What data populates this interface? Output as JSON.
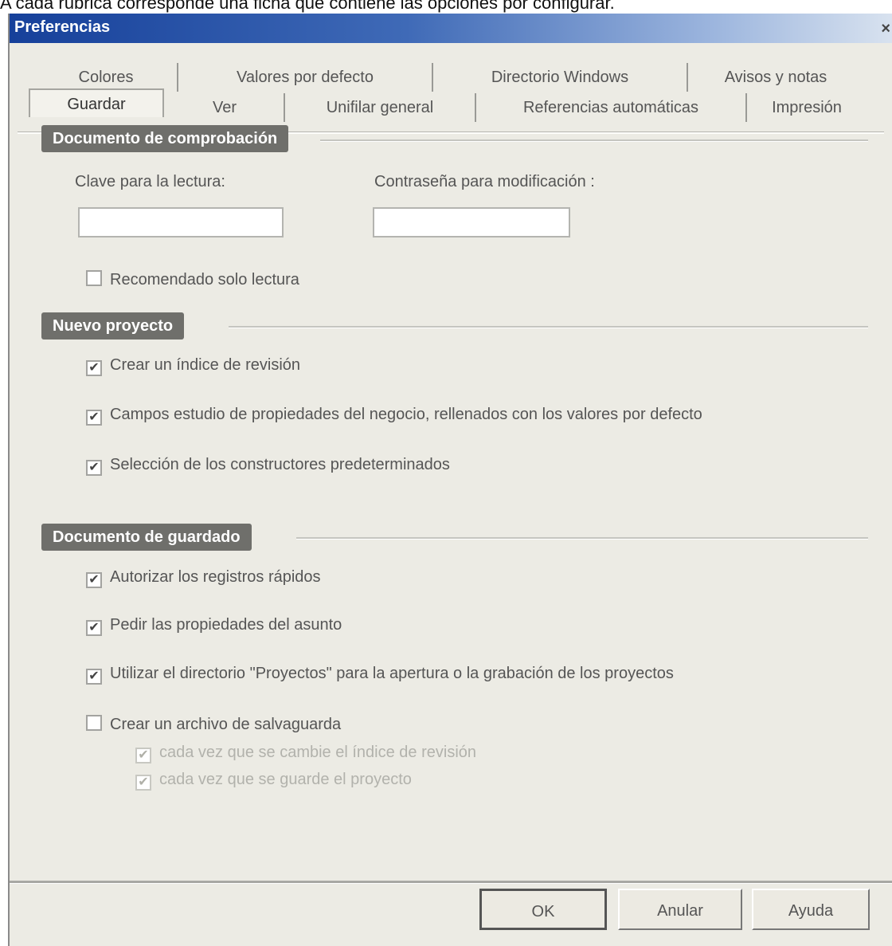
{
  "caption": "A cada rúbrica corresponde una ficha que contiene las opciones por configurar.",
  "window": {
    "title": "Preferencias"
  },
  "tabs": {
    "row1": [
      "Colores",
      "Valores por defecto",
      "Directorio Windows",
      "Avisos y notas"
    ],
    "row2": [
      "Guardar",
      "Ver",
      "Unifilar general",
      "Referencias automáticas",
      "Impresión"
    ],
    "active": "Guardar"
  },
  "sections": {
    "protection": {
      "title": "Documento de comprobación",
      "read_label": "Clave para la lectura:",
      "modify_label": "Contraseña para modificación :",
      "read_value": "",
      "modify_value": "",
      "recommend_label": "Recomendado solo lectura",
      "recommend_checked": false
    },
    "new_project": {
      "title": "Nuevo proyecto",
      "options": [
        {
          "label": "Crear un índice de revisión",
          "checked": true
        },
        {
          "label": "Campos estudio de propiedades del negocio, rellenados con los valores por defecto",
          "checked": true
        },
        {
          "label": "Selección de los constructores predeterminados",
          "checked": true
        }
      ]
    },
    "save": {
      "title": "Documento de guardado",
      "options": [
        {
          "label": "Autorizar los registros rápidos",
          "checked": true
        },
        {
          "label": "Pedir las propiedades del asunto",
          "checked": true
        },
        {
          "label": "Utilizar el directorio \"Proyectos\" para la apertura o la grabación de los proyectos",
          "checked": true
        },
        {
          "label": "Crear un archivo de salvaguarda",
          "checked": false
        }
      ],
      "sub_options": [
        {
          "label": "cada vez que se cambie el índice de revisión",
          "checked": true
        },
        {
          "label": "cada vez que se guarde el proyecto",
          "checked": true
        }
      ]
    }
  },
  "buttons": {
    "ok": "OK",
    "cancel": "Anular",
    "help": "Ayuda"
  },
  "check_glyph": "✔"
}
